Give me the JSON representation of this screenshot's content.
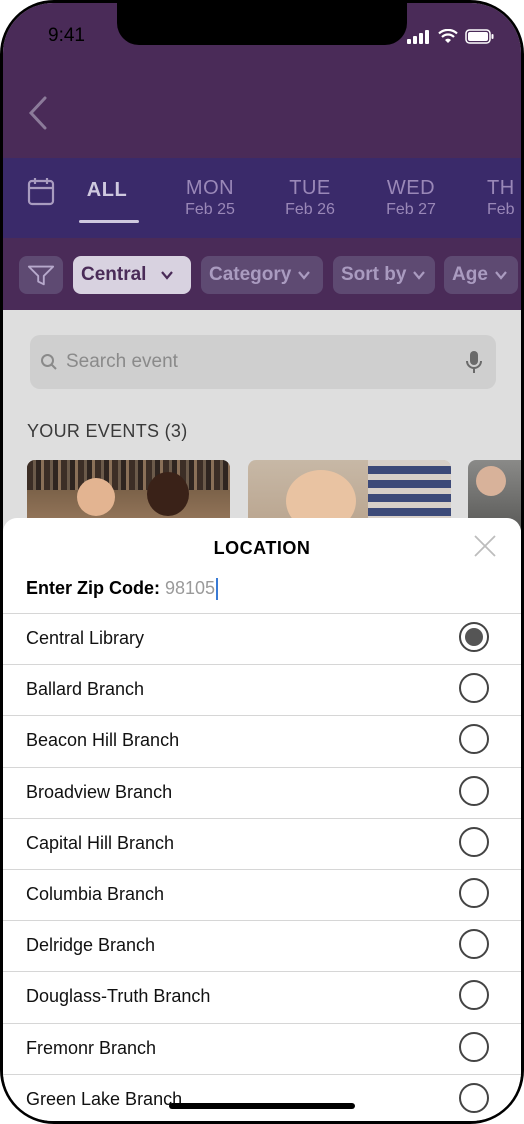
{
  "status_bar": {
    "time": "9:41"
  },
  "tabs": [
    {
      "day": "ALL",
      "date": ""
    },
    {
      "day": "MON",
      "date": "Feb 25"
    },
    {
      "day": "TUE",
      "date": "Feb 26"
    },
    {
      "day": "WED",
      "date": "Feb 27"
    },
    {
      "day": "TH",
      "date": "Feb"
    }
  ],
  "filters": {
    "location": "Central",
    "category": "Category",
    "sort": "Sort by",
    "age": "Age"
  },
  "search": {
    "placeholder": "Search event"
  },
  "your_events": {
    "label": "YOUR EVENTS (3)"
  },
  "location_sheet": {
    "title": "LOCATION",
    "zip_label": "Enter Zip Code:",
    "zip_value": "98105",
    "selected_index": 0,
    "branches": [
      "Central Library",
      "Ballard Branch",
      "Beacon Hill Branch",
      "Broadview Branch",
      "Capital Hill Branch",
      "Columbia Branch",
      "Delridge Branch",
      "Douglass-Truth Branch",
      "Fremonr Branch",
      "Green Lake Branch"
    ]
  },
  "colors": {
    "header": "#4a2b58",
    "tabs": "#3a2a6a",
    "sheet": "#ffffff",
    "caret": "#3a7bd5"
  }
}
